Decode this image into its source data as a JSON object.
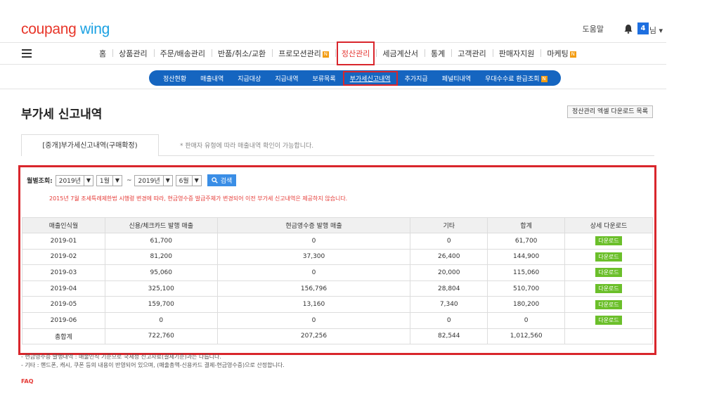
{
  "header": {
    "logo_part1": "coupang",
    "logo_part2": "wing",
    "help": "도움말",
    "notification_count": "4",
    "user": "님 ▾"
  },
  "gnb": {
    "items": [
      {
        "label": "홈"
      },
      {
        "label": "상품관리"
      },
      {
        "label": "주문/배송관리"
      },
      {
        "label": "반품/취소/교환"
      },
      {
        "label": "프로모션관리",
        "badge": "N"
      },
      {
        "label": "정산관리",
        "active": true
      },
      {
        "label": "세금계산서"
      },
      {
        "label": "통계"
      },
      {
        "label": "고객관리"
      },
      {
        "label": "판매자지원"
      },
      {
        "label": "마케팅",
        "badge": "N"
      }
    ]
  },
  "subnav": {
    "items": [
      {
        "label": "정산현황"
      },
      {
        "label": "매출내역"
      },
      {
        "label": "지급대상"
      },
      {
        "label": "지급내역"
      },
      {
        "label": "보류목록"
      },
      {
        "label": "부가세신고내역",
        "active": true
      },
      {
        "label": "추가지급"
      },
      {
        "label": "페널티내역"
      },
      {
        "label": "우대수수료 환급조회",
        "badge": "N"
      }
    ]
  },
  "page": {
    "title": "부가세 신고내역",
    "export_button": "정산관리 엑셀 다운로드 목록",
    "tab_active": "[중개]부가세신고내역(구매확정)",
    "tab_note": "* 판매자 유형에 따라 매출내역 확인이 가능합니다."
  },
  "filter": {
    "label": "월별조회:",
    "from_year": "2019년",
    "from_month": "1월",
    "tilde": "~",
    "to_year": "2019년",
    "to_month": "6월",
    "search_button": "검색"
  },
  "notice": "2015년 7월 조세특례제한법 시행령 변경에 따라, 현금영수증 발급주체가 변경되어 이전 부가세 신고내역은 제공하지 않습니다.",
  "table": {
    "headers": [
      "매출인식월",
      "신용/체크카드 발행 매출",
      "현금영수증 발행 매출",
      "기타",
      "합계",
      "상세 다운로드"
    ],
    "rows": [
      {
        "month": "2019-01",
        "card": "61,700",
        "cash": "0",
        "etc": "0",
        "total": "61,700",
        "download": "다운로드"
      },
      {
        "month": "2019-02",
        "card": "81,200",
        "cash": "37,300",
        "etc": "26,400",
        "total": "144,900",
        "download": "다운로드"
      },
      {
        "month": "2019-03",
        "card": "95,060",
        "cash": "0",
        "etc": "20,000",
        "total": "115,060",
        "download": "다운로드"
      },
      {
        "month": "2019-04",
        "card": "325,100",
        "cash": "156,796",
        "etc": "28,804",
        "total": "510,700",
        "download": "다운로드"
      },
      {
        "month": "2019-05",
        "card": "159,700",
        "cash": "13,160",
        "etc": "7,340",
        "total": "180,200",
        "download": "다운로드"
      },
      {
        "month": "2019-06",
        "card": "0",
        "cash": "0",
        "etc": "0",
        "total": "0",
        "download": "다운로드"
      }
    ],
    "summary": {
      "label": "총합계",
      "card": "722,760",
      "cash": "207,256",
      "etc": "82,544",
      "total": "1,012,560"
    }
  },
  "footnotes": [
    "- 현금영수증 발행내역 : 매출인식 기준으로 국세청 신고자료(결제기준)과는 다릅니다.",
    "- 기타 : 핸드폰, 캐시, 쿠폰 등의 내용이 반영되어 있으며, (매출총액-신용카드 결제-현금영수증)으로 산정합니다."
  ],
  "faq": "FAQ",
  "colors": {
    "accent_red": "#d9262c",
    "nav_blue": "#1565c0",
    "download_green": "#6bbf2a",
    "badge_blue": "#1e6fe0"
  }
}
